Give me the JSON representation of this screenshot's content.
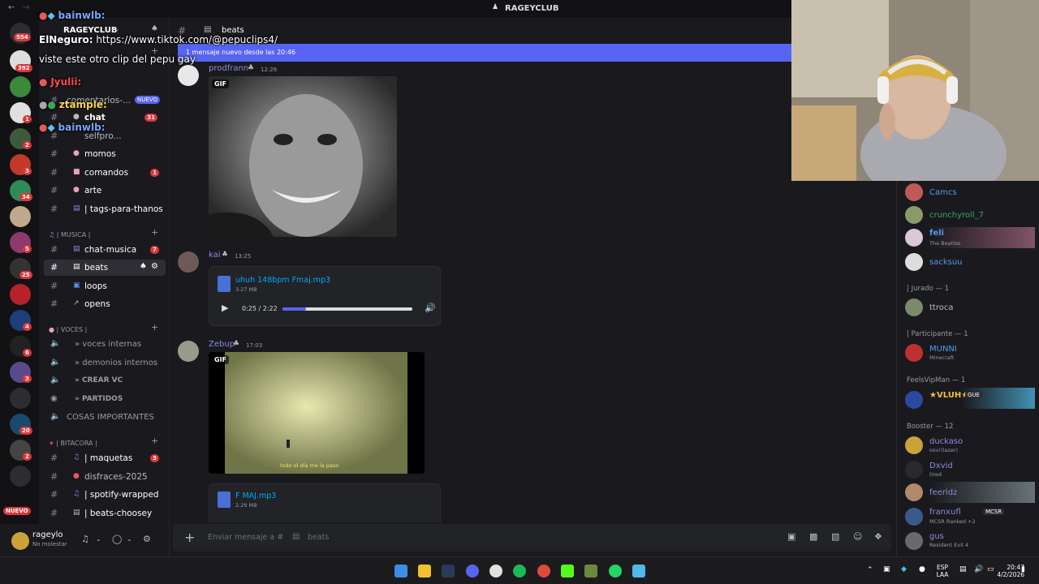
{
  "window": {
    "title": "RAGEYCLUB"
  },
  "server": {
    "name": "RAGEYCLUB"
  },
  "rail_badges": [
    "554",
    "392",
    "1",
    "2",
    "3",
    "34",
    "5",
    "25",
    "4",
    "6",
    "3",
    "20",
    "2"
  ],
  "rail_new": "NUEVO",
  "sidebar": {
    "channels_top": [
      {
        "label": "comentarios-...",
        "badge": "NUEVO"
      },
      {
        "label": "chat",
        "count": "31"
      },
      {
        "label": "selfpro...",
        "count": ""
      },
      {
        "label": "momos",
        "count": ""
      },
      {
        "label": "comandos",
        "count": "1"
      },
      {
        "label": "arte",
        "count": ""
      },
      {
        "label": "| tags-para-thanos",
        "count": ""
      }
    ],
    "cat_musica": "| MUSICA |",
    "musica_channels": [
      {
        "label": "chat-musica",
        "count": "7"
      },
      {
        "label": "beats",
        "count": ""
      },
      {
        "label": "loops",
        "count": ""
      },
      {
        "label": "opens",
        "count": ""
      }
    ],
    "cat_voces": "| VOCES |",
    "voice_channels": [
      {
        "label": "» voces internas"
      },
      {
        "label": "» demonios internos"
      },
      {
        "label": "» CREAR VC"
      },
      {
        "label": "» PARTIDOS"
      },
      {
        "label": "COSAS IMPORTANTES"
      }
    ],
    "cat_bitacora": "| BITACORA |",
    "bitacora_channels": [
      {
        "label": "| maquetas",
        "count": "3"
      },
      {
        "label": "disfraces-2025",
        "count": ""
      },
      {
        "label": "| spotify-wrapped",
        "count": ""
      },
      {
        "label": "| beats-choosey",
        "count": ""
      }
    ]
  },
  "user": {
    "name": "rageylo",
    "status": "No molestar"
  },
  "chat": {
    "channel": "beats",
    "new_since": "1 mensaje nuevo desde las 20:46",
    "composer_placeholder": "Enviar mensaje a #",
    "composer_channel": "beats",
    "messages": [
      {
        "author": "prodfrann",
        "time": "12:26",
        "gif_label": "GIF"
      },
      {
        "author": "kai",
        "time": "13:25",
        "file": "uhuh 148bpm Fmaj.mp3",
        "size": "3.27 MB",
        "player_time": "0:25 / 2:22",
        "progress": 0.18
      },
      {
        "author": "Zebup",
        "time": "17:03",
        "gif_label": "GIF",
        "caption": "todo el día me la paso"
      },
      {
        "author": "",
        "time": "",
        "file": "F MAJ.mp3",
        "size": "2.29 MB"
      }
    ]
  },
  "members": {
    "list": [
      {
        "name": "Camcs",
        "sub": "",
        "color": "#4f9cf0"
      },
      {
        "name": "crunchyroll_7",
        "sub": "",
        "color": "#3ba55c"
      },
      {
        "name": "feli",
        "sub": "The Beatles",
        "color": "#4f9cf0"
      },
      {
        "name": "sacksuu",
        "sub": "",
        "color": "#4f9cf0"
      }
    ],
    "sec_jurado": "| Jurado — 1",
    "jurado": {
      "name": "ttroca"
    },
    "sec_participante": "| Participante — 1",
    "participante": {
      "name": "MUNNI",
      "sub": "Minecraft"
    },
    "sec_feels": "FeelsVipMan — 1",
    "feels": {
      "name": "★VLUH★",
      "tag": "GUE"
    },
    "sec_booster": "Booster — 12",
    "boosters": [
      {
        "name": "duckaso",
        "sub": "osu!(lazer)"
      },
      {
        "name": "Dxvid",
        "sub": "tired"
      },
      {
        "name": "feerldz",
        "sub": ""
      },
      {
        "name": "franxufl",
        "tag": "MCSR",
        "sub": "MCSR Ranked +2"
      },
      {
        "name": "gus",
        "sub": "Resident Evil 4"
      }
    ]
  },
  "overlay": [
    {
      "name": "bainwlb:",
      "text": "",
      "color": "#7aa6ff"
    },
    {
      "name": "ElNeguro:",
      "text": "https://www.tiktok.com/@pepuclips4/",
      "color": "#ffffff"
    },
    {
      "name": "",
      "text": "viste este otro clip del pepu gay",
      "color": "#ffffff"
    },
    {
      "name": "Jyulii:",
      "text": "",
      "color": "#ff4b4b"
    },
    {
      "name": "ztample:",
      "text": "",
      "color": "#ffd84a"
    },
    {
      "name": "bainwlb:",
      "text": "",
      "color": "#7aa6ff"
    }
  ],
  "taskbar": {
    "lang": "ESP",
    "lang2": "LAA",
    "time": "20:47",
    "date": "4/2/2026"
  }
}
